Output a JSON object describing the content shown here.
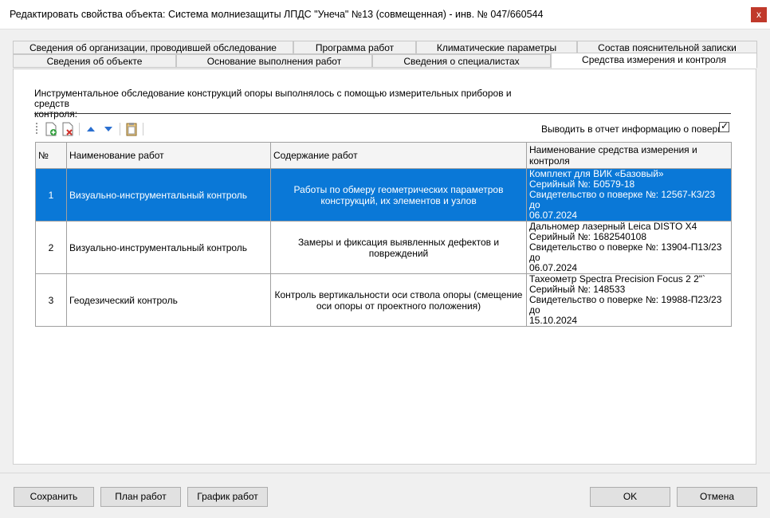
{
  "window": {
    "title": "Редактировать свойства объекта: Система молниезащиты ЛПДС \"Унеча\" №13 (совмещенная) - инв. № 047/660544",
    "close_label": "x"
  },
  "tabs_row1": [
    {
      "label": "Сведения об организации, проводившей обследование"
    },
    {
      "label": "Программа работ"
    },
    {
      "label": "Климатические параметры"
    },
    {
      "label": "Состав пояснительной записки"
    }
  ],
  "tabs_row2": [
    {
      "label": "Сведения об объекте"
    },
    {
      "label": "Основание выполнения работ"
    },
    {
      "label": "Сведения о специалистах"
    },
    {
      "label": "Средства измерения и контроля"
    }
  ],
  "active_tab": "Средства измерения и контроля",
  "panel": {
    "intro_line1": "Инструментальное обследование конструкций опоры выполнялось с помощью измерительных приборов и средств",
    "intro_line2": "контроля:",
    "checkbox_label": "Выводить в отчет информацию о поверке",
    "checkbox_checked": true,
    "checkbox_mark": "✓"
  },
  "toolbar": {
    "icons": [
      "add-row-icon",
      "delete-row-icon",
      "move-up-icon",
      "move-down-icon",
      "paste-icon"
    ]
  },
  "table": {
    "headers": [
      "№",
      "Наименование работ",
      "Содержание работ",
      "Наименование средства измерения и контроля"
    ],
    "rows": [
      {
        "num": "1",
        "name": "Визуально-инструментальный контроль",
        "content": "Работы по обмеру геометрических параметров конструкций, их элементов и узлов",
        "tool": [
          "Комплект для ВИК  «Базовый»",
          "Серийный №: Б0579-18",
          "Свидетельство о поверке №: 12567-К3/23 до",
          "06.07.2024"
        ],
        "selected": true
      },
      {
        "num": "2",
        "name": "Визуально-инструментальный контроль",
        "content": "Замеры и фиксация выявленных дефектов и повреждений",
        "tool": [
          "Дальномер лазерный Leica DISTO X4",
          "Серийный №: 1682540108",
          "Свидетельство о поверке №: 13904-П13/23 до",
          "06.07.2024"
        ],
        "selected": false
      },
      {
        "num": "3",
        "name": "Геодезический контроль",
        "content": "Контроль вертикальности оси ствола опоры (смещение оси опоры от проектного положения)",
        "tool": [
          "Тахеометр Spectra Precision Focus 2 2\"`",
          "Серийный №: 148533",
          "Свидетельство о поверке №: 19988-П23/23 до",
          "15.10.2024"
        ],
        "selected": false
      }
    ]
  },
  "buttons": {
    "save": "Сохранить",
    "plan": "План работ",
    "schedule": "График работ",
    "ok": "OK",
    "cancel": "Отмена"
  },
  "colors": {
    "selection": "#0a78d7",
    "close": "#c0392b"
  }
}
